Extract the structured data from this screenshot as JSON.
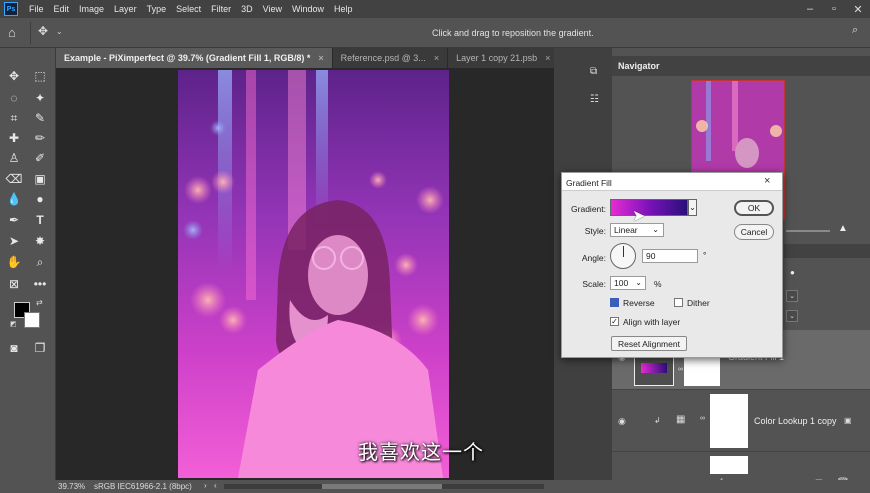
{
  "menubar": {
    "logo": "Ps",
    "items": [
      "File",
      "Edit",
      "Image",
      "Layer",
      "Type",
      "Select",
      "Filter",
      "3D",
      "View",
      "Window",
      "Help"
    ]
  },
  "options": {
    "hint": "Click and drag to reposition the gradient."
  },
  "tabs": [
    {
      "label": "Example - PiXimperfect @ 39.7% (Gradient Fill 1, RGB/8) *",
      "close": "×"
    },
    {
      "label": "Reference.psd @ 3...",
      "close": "×"
    },
    {
      "label": "Layer 1 copy 21.psb",
      "close": "×"
    }
  ],
  "navigator": {
    "title": "Navigator"
  },
  "dialog": {
    "title": "Gradient Fill",
    "close": "×",
    "gradient_label": "Gradient:",
    "style_label": "Style:",
    "style_value": "Linear",
    "angle_label": "Angle:",
    "angle_value": "90",
    "angle_unit": "°",
    "scale_label": "Scale:",
    "scale_value": "100",
    "scale_unit": "%",
    "reverse_label": "Reverse",
    "dither_label": "Dither",
    "align_label": "Align with layer",
    "reset_label": "Reset Alignment",
    "ok_label": "OK",
    "cancel_label": "Cancel",
    "gradient_colors": [
      "#e82bd6",
      "#7a13b8",
      "#2a0f7a"
    ]
  },
  "layers": [
    {
      "name": "Gradient Fill 1"
    },
    {
      "name": "Color Lookup 1 copy"
    }
  ],
  "status": {
    "zoom": "39.73%",
    "profile": "sRGB IEC61966-2.1 (8bpc)"
  },
  "subtitle": "我喜欢这一个"
}
